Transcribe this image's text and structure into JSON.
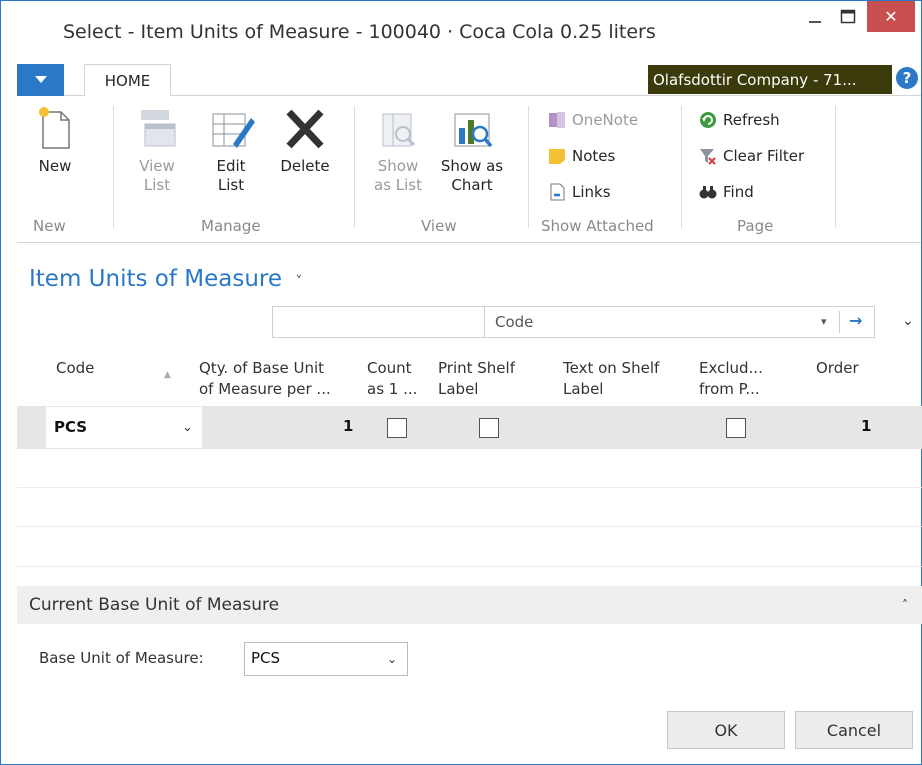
{
  "window": {
    "title": "Select - Item Units of Measure - 100040 · Coca Cola 0.25 liters",
    "close_glyph": "✕"
  },
  "ribbon": {
    "tab": "HOME",
    "company": "Olafsdottir Company - 71...",
    "help_glyph": "?",
    "groups": {
      "new": "New",
      "manage": "Manage",
      "view": "View",
      "show_attached": "Show Attached",
      "page": "Page"
    },
    "buttons": {
      "new": "New",
      "view_list_1": "View",
      "view_list_2": "List",
      "edit_list_1": "Edit",
      "edit_list_2": "List",
      "delete": "Delete",
      "show_list_1": "Show",
      "show_list_2": "as List",
      "show_chart_1": "Show as",
      "show_chart_2": "Chart",
      "onenote": "OneNote",
      "notes": "Notes",
      "links": "Links",
      "refresh": "Refresh",
      "clear_filter": "Clear Filter",
      "find": "Find"
    },
    "icons": [
      "new-document-icon",
      "view-list-icon",
      "edit-list-icon",
      "delete-icon",
      "show-as-list-icon",
      "show-as-chart-icon",
      "onenote-icon",
      "notes-icon",
      "links-icon",
      "refresh-icon",
      "clear-filter-icon",
      "find-icon"
    ]
  },
  "page": {
    "title": "Item Units of Measure",
    "title_chevron": "˅"
  },
  "filter": {
    "field": "Code",
    "dropdown_glyph": "▾",
    "go_glyph": "→",
    "expand_glyph": "⌄"
  },
  "table": {
    "headers": {
      "code": "Code",
      "qty_1": "Qty. of Base Unit",
      "qty_2": "of Measure per ...",
      "count_1": "Count",
      "count_2": "as 1 ...",
      "print_1": "Print Shelf",
      "print_2": "Label",
      "text_1": "Text on Shelf",
      "text_2": "Label",
      "exclude_1": "Exclud...",
      "exclude_2": "from P...",
      "order": "Order"
    },
    "sort_glyph": "▲",
    "rows": [
      {
        "code": "PCS",
        "code_chevron": "⌄",
        "qty": "1",
        "count_as_1": false,
        "print_shelf_label": false,
        "text_on_shelf_label": "",
        "exclude": false,
        "order": "1"
      }
    ]
  },
  "current_base": {
    "section_title": "Current Base Unit of Measure",
    "collapse_glyph": "˄",
    "label": "Base Unit of Measure:",
    "value": "PCS",
    "chevron": "⌄"
  },
  "actions": {
    "ok": "OK",
    "cancel": "Cancel"
  },
  "colors": {
    "accent": "#2b79c6",
    "company_bg": "#3a3a0a",
    "close_bg": "#c74f4f",
    "selected_row": "#e6e6e6"
  }
}
